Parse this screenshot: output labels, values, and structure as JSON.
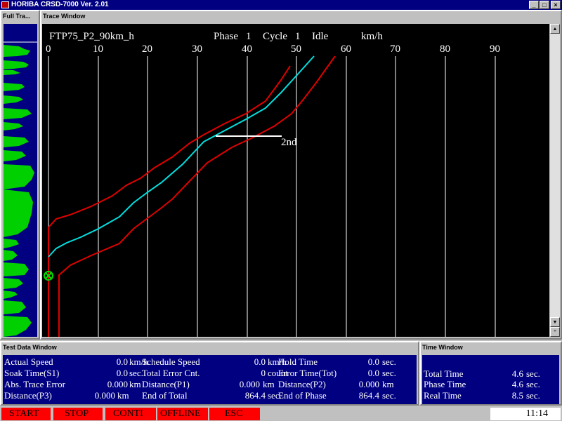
{
  "window": {
    "title": "HORIBA CRSD-7000 Ver. 2.01",
    "minimize_glyph": "_",
    "maximize_glyph": "□",
    "close_glyph": "×"
  },
  "full_trace": {
    "header": "Full Tra..."
  },
  "trace": {
    "header": "Trace Window",
    "mode_name": "FTP75_P2_90km_h",
    "phase_label": "Phase",
    "phase_value": "1",
    "cycle_label": "Cycle",
    "cycle_value": "1",
    "state": "Idle",
    "unit": "km/h",
    "gear_label": "2nd",
    "speed_ticks": [
      "0",
      "10",
      "20",
      "30",
      "40",
      "50",
      "60",
      "70",
      "80",
      "90"
    ],
    "colors": {
      "schedule": "#00e0e0",
      "tolerance": "#e00000",
      "grid": "#ffffff",
      "marker": "#00e000"
    },
    "scroll_up_glyph": "▲",
    "scroll_down_glyph": "▼",
    "corner_glyph": "*"
  },
  "test_data": {
    "header": "Test Data Window",
    "rows": [
      [
        {
          "label": "Actual Speed",
          "value": "0.0",
          "unit": "km/h"
        },
        {
          "label": "Schedule Speed",
          "value": "0.0",
          "unit": "km/h"
        },
        {
          "label": "Hold Time",
          "value": "0.0",
          "unit": "sec."
        }
      ],
      [
        {
          "label": "Soak Time(S1)",
          "value": "0.0",
          "unit": "sec."
        },
        {
          "label": "Total Error Cnt.",
          "value": "0",
          "unit": "count"
        },
        {
          "label": "Error Time(Tot)",
          "value": "0.0",
          "unit": "sec."
        }
      ],
      [
        {
          "label": "Abs. Trace Error",
          "value": "0.000",
          "unit": "km"
        },
        {
          "label": "Distance(P1)",
          "value": "0.000",
          "unit": "km"
        },
        {
          "label": "Distance(P2)",
          "value": "0.000",
          "unit": "km"
        }
      ],
      [
        {
          "label": "Distance(P3)",
          "value": "0.000",
          "unit": "km"
        },
        {
          "label": "End of Total",
          "value": "864.4",
          "unit": "sec."
        },
        {
          "label": "End of Phase",
          "value": "864.4",
          "unit": "sec."
        }
      ]
    ]
  },
  "time_window": {
    "header": "Time Window",
    "rows": [
      {
        "label": "Total Time",
        "value": "4.6",
        "unit": "sec."
      },
      {
        "label": "Phase Time",
        "value": "4.6",
        "unit": "sec."
      },
      {
        "label": "Real Time",
        "value": "8.5",
        "unit": "sec."
      }
    ]
  },
  "function_keys": [
    "START",
    "STOP",
    "CONTI",
    "OFFLINE",
    "ESC"
  ],
  "clock": "11:14"
}
